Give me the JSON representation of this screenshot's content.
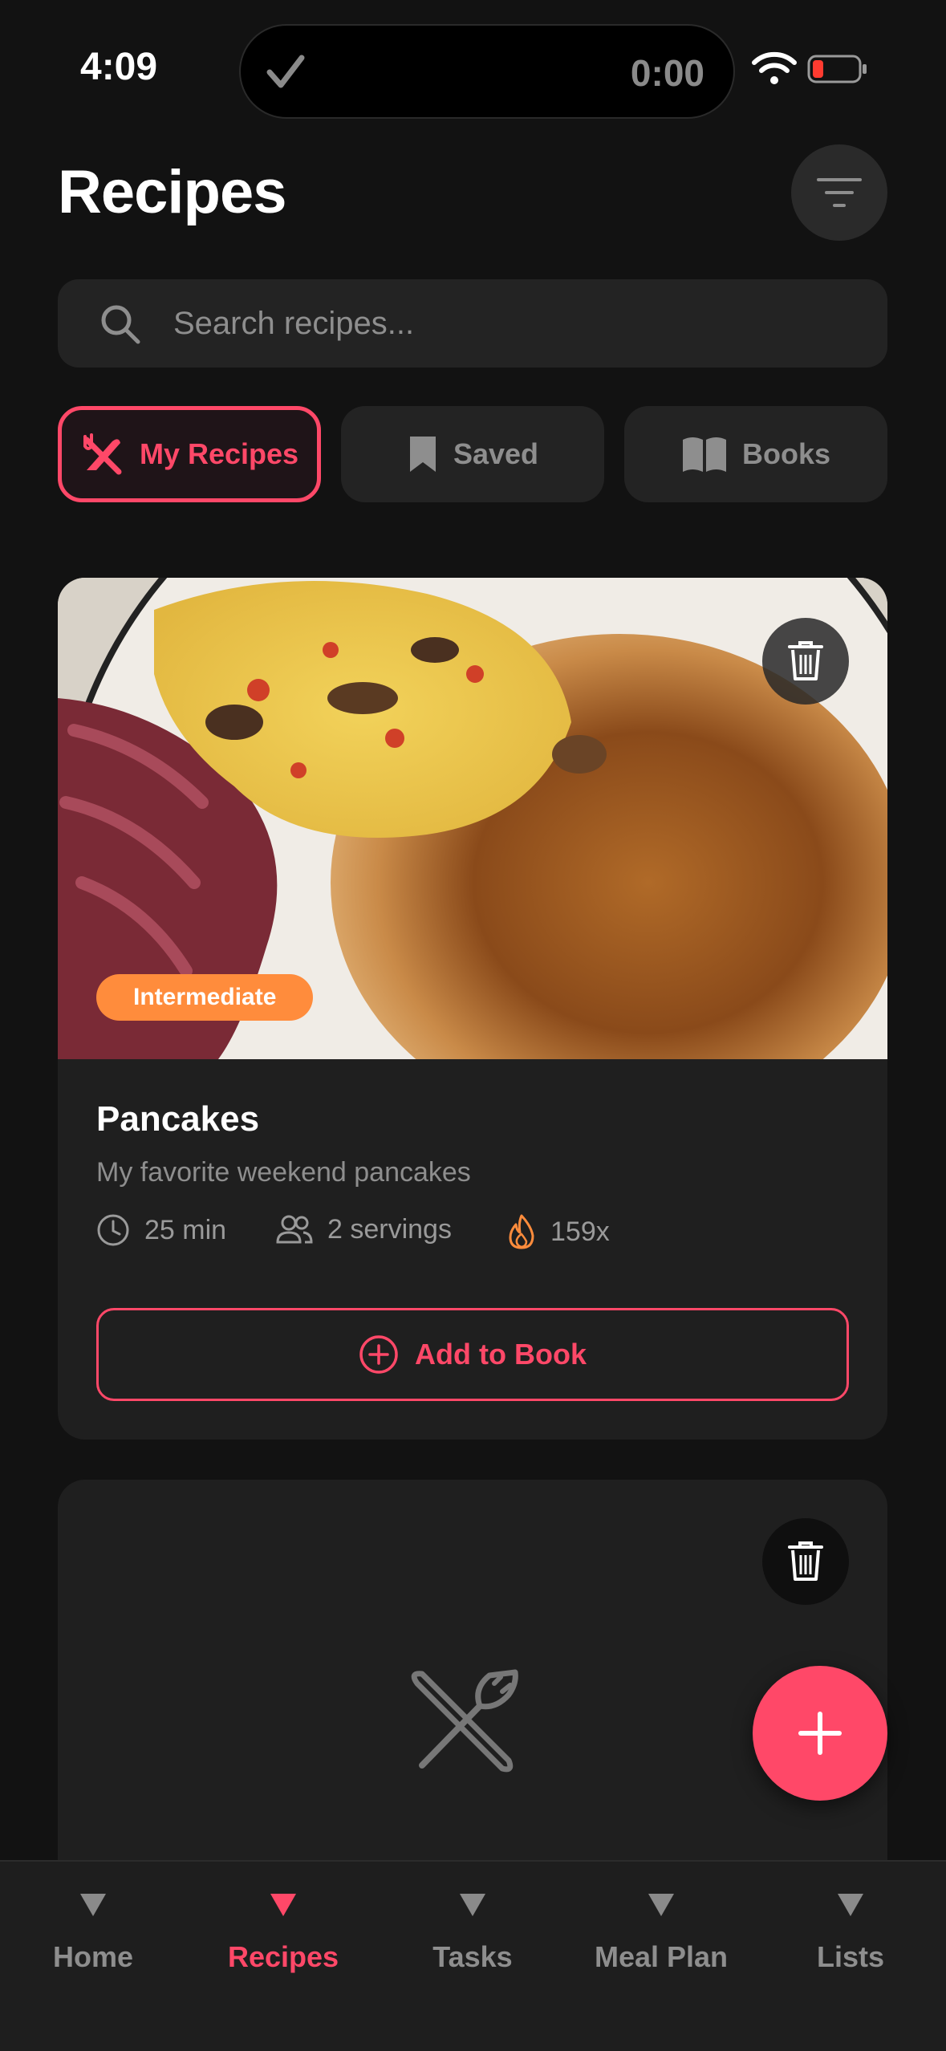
{
  "status_bar": {
    "time": "4:09",
    "timer": "0:00",
    "battery_color": "#ff3b30"
  },
  "header": {
    "title": "Recipes",
    "filter_icon": "filter-icon"
  },
  "search": {
    "placeholder": "Search recipes...",
    "value": ""
  },
  "tabs": [
    {
      "label": "My Recipes",
      "icon": "fork-knife-icon",
      "active": true
    },
    {
      "label": "Saved",
      "icon": "bookmark-icon",
      "active": false
    },
    {
      "label": "Books",
      "icon": "book-icon",
      "active": false
    }
  ],
  "recipes": [
    {
      "title": "Pancakes",
      "description": "My favorite weekend pancakes",
      "difficulty": "Intermediate",
      "time": "25 min",
      "servings": "2 servings",
      "cooked_count": "159x",
      "add_to_book_label": "Add to Book"
    }
  ],
  "nav": [
    {
      "label": "Home",
      "active": false
    },
    {
      "label": "Recipes",
      "active": true
    },
    {
      "label": "Tasks",
      "active": false
    },
    {
      "label": "Meal Plan",
      "active": false
    },
    {
      "label": "Lists",
      "active": false
    }
  ],
  "colors": {
    "accent": "#ff4868",
    "difficulty_badge": "#ff8c3c",
    "background": "#121212",
    "card": "#1f1f1f"
  }
}
